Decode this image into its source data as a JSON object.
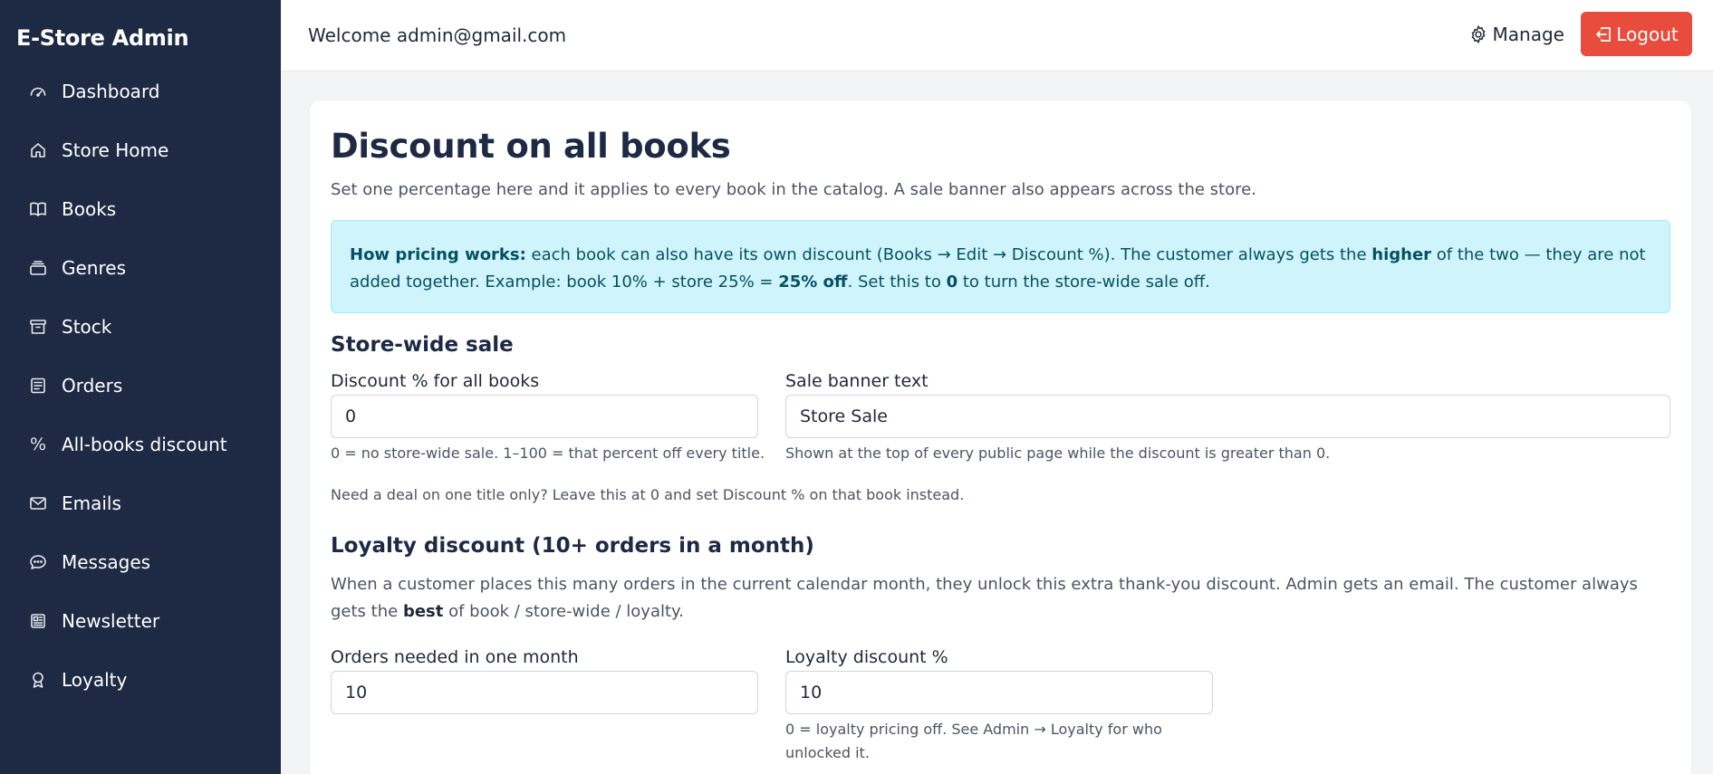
{
  "sidebar": {
    "brand": "E-Store Admin",
    "items": [
      {
        "label": "Dashboard",
        "icon": "speedometer-icon"
      },
      {
        "label": "Store Home",
        "icon": "house-icon"
      },
      {
        "label": "Books",
        "icon": "book-icon"
      },
      {
        "label": "Genres",
        "icon": "collection-icon"
      },
      {
        "label": "Stock",
        "icon": "archive-icon"
      },
      {
        "label": "Orders",
        "icon": "receipt-icon"
      },
      {
        "label": "All-books discount",
        "icon": "percent-icon"
      },
      {
        "label": "Emails",
        "icon": "envelope-icon"
      },
      {
        "label": "Messages",
        "icon": "chat-icon"
      },
      {
        "label": "Newsletter",
        "icon": "newspaper-icon"
      },
      {
        "label": "Loyalty",
        "icon": "award-icon"
      }
    ]
  },
  "topbar": {
    "welcome": "Welcome admin@gmail.com",
    "manage": "Manage",
    "logout": "Logout"
  },
  "page": {
    "title": "Discount on all books",
    "subtitle": "Set one percentage here and it applies to every book in the catalog. A sale banner also appears across the store.",
    "info": {
      "lead": "How pricing works:",
      "text1": " each book can also have its own discount (Books → Edit → Discount %). The customer always gets the ",
      "higher": "higher",
      "text2": " of the two — they are not added together. Example: book 10% + store 25% = ",
      "result": "25% off",
      "text3": ". Set this to ",
      "zero": "0",
      "text4": " to turn the store-wide sale off."
    },
    "store_sale": {
      "heading": "Store-wide sale",
      "discount_label": "Discount % for all books",
      "discount_value": "0",
      "discount_help": "0 = no store-wide sale. 1–100 = that percent off every title.",
      "banner_label": "Sale banner text",
      "banner_value": "Store Sale",
      "banner_help": "Shown at the top of every public page while the discount is greater than 0.",
      "note": "Need a deal on one title only? Leave this at 0 and set Discount % on that book instead."
    },
    "loyalty": {
      "heading": "Loyalty discount (10+ orders in a month)",
      "desc1": "When a customer places this many orders in the current calendar month, they unlock this extra thank-you discount. Admin gets an email. The customer always gets the",
      "best": "best",
      "desc2": " of book / store-wide / loyalty.",
      "orders_label": "Orders needed in one month",
      "orders_value": "10",
      "pct_label": "Loyalty discount %",
      "pct_value": "10",
      "pct_help": "0 = loyalty pricing off. See Admin → Loyalty for who unlocked it."
    }
  },
  "colors": {
    "sidebar_bg": "#1e2a44",
    "logout_bg": "#e74c3c",
    "info_bg": "#cff4fc",
    "info_text": "#055160"
  }
}
